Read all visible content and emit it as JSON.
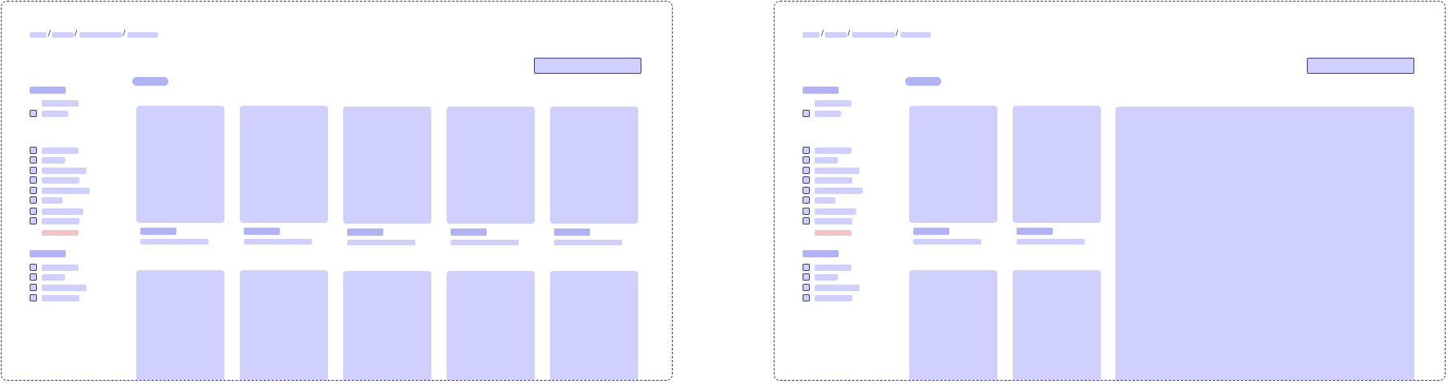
{
  "diagram": {
    "description_free": true,
    "breadcrumb_separator": "/",
    "colors": {
      "frame_border": "#3a3585",
      "placeholder_light": "#cfd0fc",
      "placeholder_medium": "#b1b2f1",
      "reset_placeholder": "#f4c2c8",
      "background": "#ffffff"
    },
    "wireframes": [
      {
        "id": "left",
        "layout": "grid-5-columns",
        "breadcrumb_segments": 4,
        "filter_groups": 3,
        "card_columns": 5,
        "card_rows": 2
      },
      {
        "id": "right",
        "layout": "grid-2-columns-with-detail-panel",
        "breadcrumb_segments": 4,
        "filter_groups": 3,
        "card_columns": 2,
        "card_rows": 2
      }
    ]
  }
}
